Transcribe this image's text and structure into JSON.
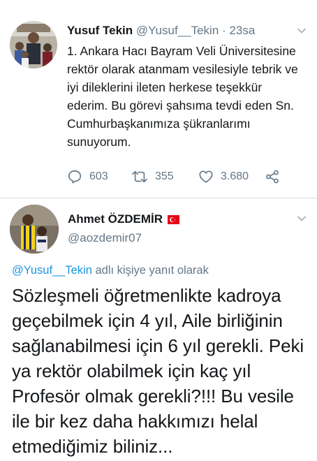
{
  "tweet1": {
    "author_name": "Yusuf Tekin",
    "author_handle": "@Yusuf__Tekin",
    "separator": "·",
    "time": "23sa",
    "text": "1. Ankara Hacı Bayram Veli Üniversitesine rektör olarak atanmam vesilesiyle tebrik ve iyi dileklerini ileten herkese teşekkür ederim. Bu görevi şahsıma tevdi eden Sn. Cumhurbaşkanımıza şükranlarımı sunuyorum.",
    "replies": "603",
    "retweets": "355",
    "likes": "3.680",
    "icons": [
      "reply-icon",
      "retweet-icon",
      "like-icon",
      "share-icon",
      "chevron-down-icon"
    ]
  },
  "tweet2": {
    "author_name": "Ahmet ÖZDEMİR",
    "author_handle": "@aozdemir07",
    "flag": "turkey-flag-emoji",
    "reply_to_handle": "@Yusuf__Tekin",
    "reply_to_suffix": "adlı kişiye yanıt olarak",
    "text": "Sözleşmeli öğretmenlikte kadroya geçebilmek için 4 yıl, Aile birliğinin sağlanabilmesi için 6 yıl gerekli. Peki ya rektör olabilmek için kaç yıl Profesör olmak gerekli?!!! Bu vesile ile bir kez daha hakkımızı helal etmediğimiz biliniz..."
  },
  "colors": {
    "text_primary": "#14171a",
    "text_secondary": "#657786",
    "link": "#1b95e0",
    "divider": "#d4dbe0",
    "flag_red": "#e30a17"
  }
}
